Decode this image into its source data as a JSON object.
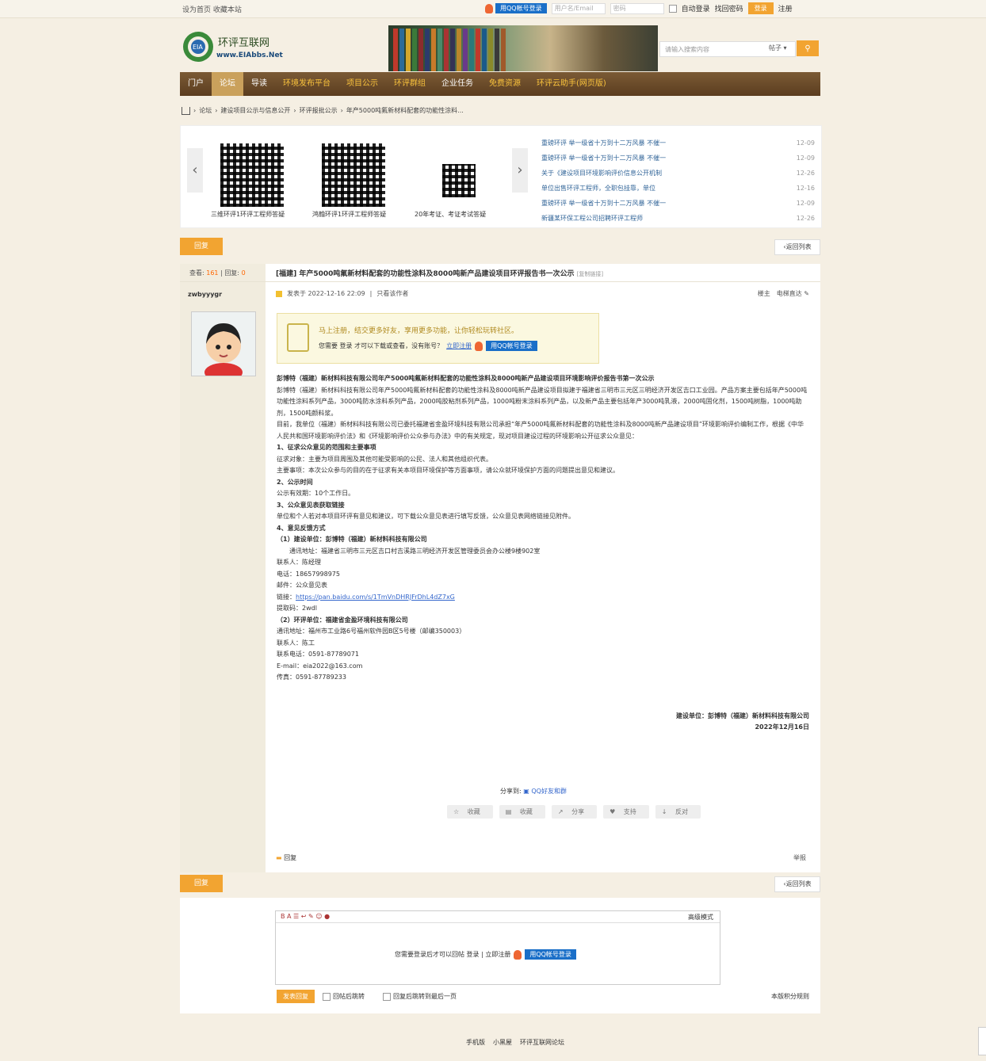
{
  "topbar": {
    "links": "设为首页 收藏本站",
    "qq_login": "用QQ帐号登录",
    "username_placeholder": "用户名/Email",
    "password_placeholder": "密码",
    "autologin": "自动登录",
    "forgot": "找回密码",
    "login": "登录",
    "register": "注册"
  },
  "header": {
    "logo_text": "环评互联网",
    "logo_url": "www.EIAbbs.Net",
    "search_placeholder": "请输入搜索内容",
    "search_type": "帖子"
  },
  "nav": {
    "items": [
      "门户",
      "论坛",
      "导读",
      "环境发布平台",
      "项目公示",
      "环评群组",
      "企业任务",
      "免费资源",
      "环评云助手(网页版)"
    ]
  },
  "breadcrumb": {
    "items": [
      "论坛",
      "建设项目公示与信息公开",
      "环评报批公示",
      "年产5000吨氟新材料配套的功能性涂料..."
    ]
  },
  "carousel": {
    "captions": [
      "三维环评1环评工程师答疑",
      "鸿翰环评1环评工程师答疑",
      "20年考证、考证考试答疑"
    ]
  },
  "news": [
    {
      "title": "重磅环评 举一级省十万到十二万风暴 不催一",
      "date": "12-09"
    },
    {
      "title": "重磅环评 举一级省十万到十二万风暴 不催一",
      "date": "12-09"
    },
    {
      "title": "关于《建设项目环境影响评价信息公开机制",
      "date": "12-26"
    },
    {
      "title": "单位出售环评工程师，全职包挂靠，单位",
      "date": "12-16"
    },
    {
      "title": "重磅环评 举一级省十万到十二万风暴 不催一",
      "date": "12-09"
    },
    {
      "title": "新疆某环保工程公司招聘环评工程师",
      "date": "12-26"
    }
  ],
  "bar": {
    "reply": "回复",
    "back": "返回列表"
  },
  "post": {
    "views_label": "查看:",
    "views": "161",
    "replies_label": "回复:",
    "replies": "0",
    "title": "[福建] 年产5000吨氟新材料配套的功能性涂料及8000吨新产品建设项目环评报告书一次公示",
    "copy_link": "[复制链接]",
    "author": "zwbyyygr",
    "posted": "发表于 2022-12-16 22:09",
    "only_author": "只看该作者",
    "floor": "楼主",
    "jump": "电梯直达",
    "notice_line1": "马上注册，结交更多好友，享用更多功能，让你轻松玩转社区。",
    "notice_line2": "您需要 登录 才可以下载或查看，没有账号？",
    "notice_register": "立即注册",
    "notice_qq": "用QQ帐号登录"
  },
  "body": [
    {
      "t": "彭博特（福建）新材料科技有限公司年产5000吨氟新材料配套的功能性涂料及8000吨新产品建设项目环境影响评价报告书第一次公示",
      "b": true
    },
    {
      "t": "彭博特（福建）新材料科技有限公司年产5000吨氟新材料配套的功能性涂料及8000吨新产品建设项目拟建于福建省三明市三元区三明经济开发区吉口工业园。产品方案主要包括年产5000吨功能性涂料系列产品，3000吨防水涂料系列产品，2000吨胶粘剂系列产品，1000吨粉末涂料系列产品，以及新产品主要包括年产3000吨乳液，2000吨固化剂，1500吨树脂，1000吨助剂，1500吨颜料浆。"
    },
    {
      "t": "目前，我单位（福建）新材料科技有限公司已委托福建省金盈环境科技有限公司承担“年产5000吨氟新材料配套的功能性涂料及8000吨新产品建设项目”环境影响评价编制工作，根据《中华人民共和国环境影响评价法》和《环境影响评价公众参与办法》中的有关规定，现对项目建设过程的环境影响公开征求公众意见："
    },
    {
      "t": "1、征求公众意见的范围和主要事项",
      "b": true
    },
    {
      "t": "征求对象：主要为项目周围及其他可能受影响的公民、法人和其他组织代表。"
    },
    {
      "t": "主要事项：本次公众参与的目的在于征求有关本项目环境保护等方面事项，请公众就环境保护方面的问题提出意见和建议。"
    },
    {
      "t": "2、公示时间",
      "b": true
    },
    {
      "t": "公示有效期：10个工作日。"
    },
    {
      "t": "3、公众意见表获取链接",
      "b": true
    },
    {
      "t": "单位和个人若对本项目环评有意见和建议，可下载公众意见表进行填写反馈，公众意见表网络链接见附件。"
    },
    {
      "t": "4、意见反馈方式",
      "b": true
    },
    {
      "t": "（1）建设单位：彭博特（福建）新材料科技有限公司",
      "b": true
    },
    {
      "t": "　　通讯地址：福建省三明市三元区吉口村吉溪路三明经济开发区管理委员会办公楼9楼902室"
    },
    {
      "t": "联系人：陈经理"
    },
    {
      "t": "电话：18657998975"
    },
    {
      "t": "邮件：公众意见表"
    },
    {
      "t": "链接：",
      "link": "https://pan.baidu.com/s/1TmVnDHRJFrDhL4dZ7xG"
    },
    {
      "t": " "
    },
    {
      "t": "提取码：2wdl"
    },
    {
      "t": "（2）环评单位：福建省金盈环境科技有限公司",
      "b": true
    },
    {
      "t": "通讯地址：福州市工业路6号福州软件园B区5号楼（邮编350003）"
    },
    {
      "t": "联系人：陈工"
    },
    {
      "t": "联系电话：0591-87789071"
    },
    {
      "t": "E-mail：eia2022@163.com"
    },
    {
      "t": "传真：0591-87789233"
    }
  ],
  "sign": {
    "org": "建设单位：彭博特（福建）新材料科技有限公司",
    "date": "2022年12月16日"
  },
  "share": {
    "label": "分享到:",
    "qzone": "QQ好友和群"
  },
  "actions": [
    "收藏",
    "收藏",
    "分享",
    "支持",
    "反对"
  ],
  "post_footer": {
    "reply": "回复",
    "report": "举报"
  },
  "reply_box": {
    "mode": "高级模式",
    "msg": "您需要登录后才可以回帖 登录 | 立即注册",
    "qq": "用QQ帐号登录",
    "submit": "发表回复",
    "opt1": "回帖后跳转",
    "opt2": "回复后跳转到最后一页",
    "rules": "本版积分规则"
  },
  "footer": [
    "手机版",
    "小黑屋",
    "环评互联网论坛"
  ],
  "colors": {
    "accent": "#f2a431",
    "nav_bg": "#6b4a28",
    "link": "#336699"
  }
}
